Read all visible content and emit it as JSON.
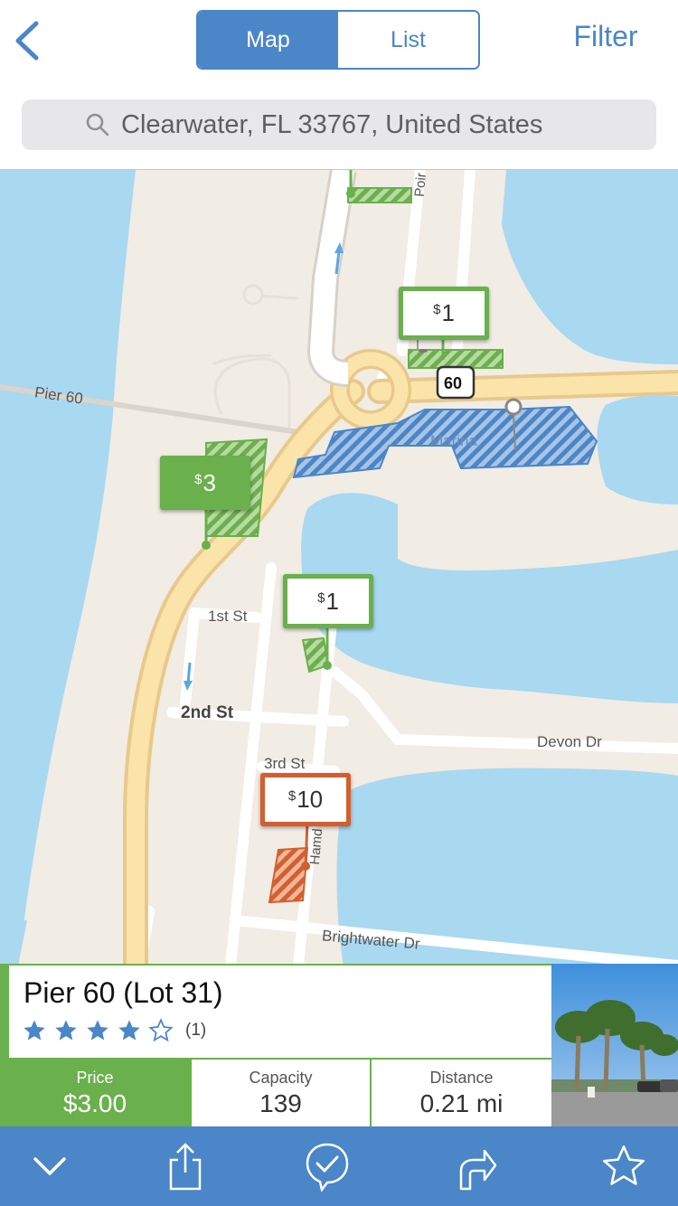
{
  "header": {
    "segments": {
      "map": "Map",
      "list": "List",
      "active": "Map"
    },
    "filter_label": "Filter",
    "search": {
      "value": "Clearwater, FL 33767, United States"
    }
  },
  "map": {
    "pins": [
      {
        "price": "1",
        "currency": "$",
        "color": "green"
      },
      {
        "price": "3",
        "currency": "$",
        "color": "green"
      },
      {
        "price": "1",
        "currency": "$",
        "color": "green"
      },
      {
        "price": "10",
        "currency": "$",
        "color": "orange"
      }
    ],
    "labels": {
      "pier": "Pier 60",
      "marina": "Marina",
      "first": "1st St",
      "second": "2nd St",
      "third": "3rd St",
      "devon": "Devon Dr",
      "brightwater": "Brightwater Dr",
      "hamden": "Hamd",
      "poinsettia": "Poir",
      "route_shield": "60"
    },
    "colors": {
      "water": "#a9d8f1",
      "land": "#f1ece4",
      "green": "#6ab04c",
      "blue": "#4a86c8",
      "orange": "#d35f2f"
    }
  },
  "card": {
    "title": "Pier 60 (Lot 31)",
    "rating": 3.5,
    "rating_count": "(1)",
    "price": {
      "label": "Price",
      "value": "$3.00"
    },
    "capacity": {
      "label": "Capacity",
      "value": "139"
    },
    "distance": {
      "label": "Distance",
      "value": "0.21 mi"
    }
  },
  "toolbar": {
    "icons": [
      "chevron-down-icon",
      "share-icon",
      "check-bubble-icon",
      "directions-icon",
      "star-icon"
    ]
  }
}
